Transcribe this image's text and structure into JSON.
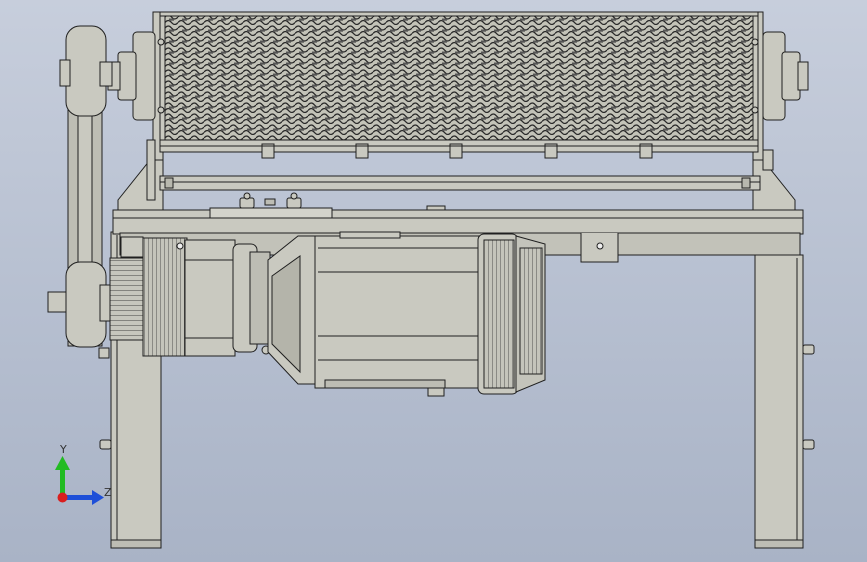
{
  "axis_triad": {
    "y_label": "Y",
    "z_label": "Z",
    "y_color": "#22bb22",
    "z_color": "#1e4fd8",
    "origin_color": "#d91e1e"
  },
  "colors": {
    "metal_fill": "#c9c9c0",
    "metal_dark": "#8f8f86",
    "outline": "#1f1f1f",
    "background": "#bcc4d4"
  }
}
